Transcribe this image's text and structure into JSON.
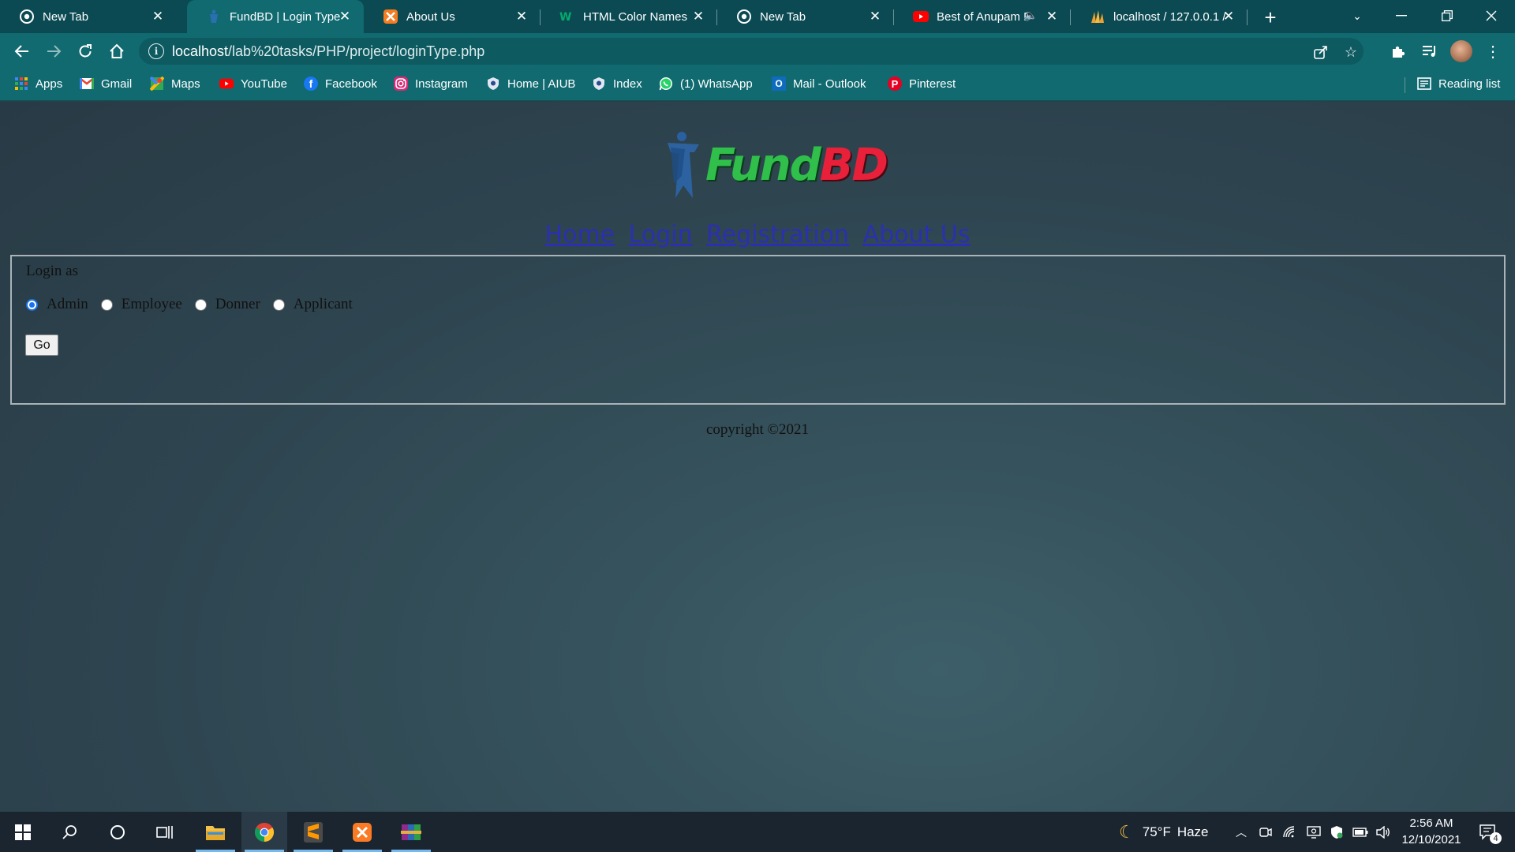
{
  "browser": {
    "tabs": [
      {
        "title": "New Tab",
        "icon": "chrome-icon"
      },
      {
        "title": "FundBD | Login Type",
        "icon": "fundbd-favicon",
        "active": true
      },
      {
        "title": "About Us",
        "icon": "xampp-icon"
      },
      {
        "title": "HTML Color Names",
        "icon": "w3schools-icon"
      },
      {
        "title": "New Tab",
        "icon": "chrome-icon"
      },
      {
        "title": "Best of Anupam F",
        "icon": "youtube-icon",
        "muted_audio_indicator": true
      },
      {
        "title": "localhost / 127.0.0.1 /",
        "icon": "phpmyadmin-icon"
      }
    ],
    "address": {
      "host": "localhost",
      "path": "/lab%20tasks/PHP/project/loginType.php"
    },
    "bookmarks": [
      {
        "label": "Apps",
        "icon": "apps-grid-icon"
      },
      {
        "label": "Gmail",
        "icon": "gmail-icon"
      },
      {
        "label": "Maps",
        "icon": "maps-icon"
      },
      {
        "label": "YouTube",
        "icon": "youtube-icon"
      },
      {
        "label": "Facebook",
        "icon": "facebook-icon"
      },
      {
        "label": "Instagram",
        "icon": "instagram-icon"
      },
      {
        "label": "Home | AIUB",
        "icon": "aiub-icon"
      },
      {
        "label": "Index",
        "icon": "aiub-icon"
      },
      {
        "label": "(1) WhatsApp",
        "icon": "whatsapp-icon"
      },
      {
        "label": "Mail - Outlook",
        "icon": "outlook-icon"
      },
      {
        "label": "Pinterest",
        "icon": "pinterest-icon"
      }
    ],
    "reading_list": "Reading list"
  },
  "page": {
    "logo": {
      "part1": "Fund",
      "part2": "BD"
    },
    "nav": [
      "Home",
      "Login",
      "Registration",
      "About Us"
    ],
    "form": {
      "legend": "Login as",
      "options": [
        {
          "label": "Admin",
          "checked": true
        },
        {
          "label": "Employee",
          "checked": false
        },
        {
          "label": "Donner",
          "checked": false
        },
        {
          "label": "Applicant",
          "checked": false
        }
      ],
      "submit": "Go"
    },
    "copyright": "copyright ©2021"
  },
  "taskbar": {
    "weather": {
      "temp": "75°F",
      "condition": "Haze"
    },
    "time": "2:56 AM",
    "date": "12/10/2021",
    "notification_count": "4"
  },
  "colors": {
    "tab_strip": "#0b4a53",
    "toolbar": "#106a70",
    "page_bg": "#2f4650",
    "link": "#2b2fb0",
    "logo_fund": "#2fbf4a",
    "logo_bd": "#e8203a",
    "radio_checked": "#1a73e8",
    "taskbar": "#1a2530"
  }
}
